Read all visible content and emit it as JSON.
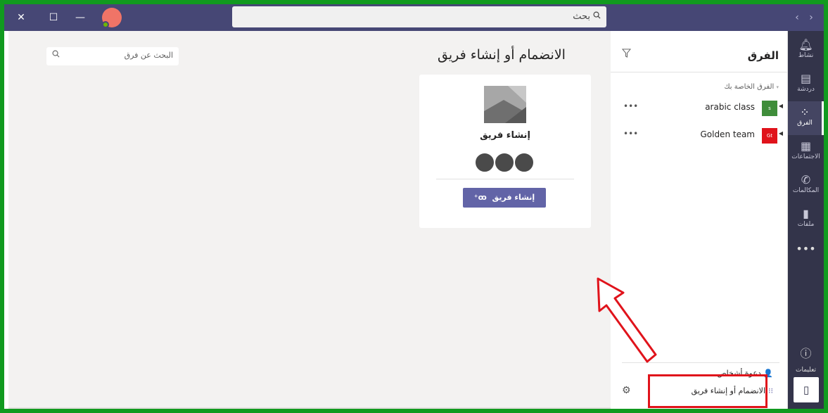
{
  "titlebar": {
    "close_icon": "✕",
    "maximize_icon": "☐",
    "minimize_icon": "—",
    "search_text": "بحث",
    "search_icon": "search-icon",
    "nav_back": "‹",
    "nav_forward": "›"
  },
  "rail": {
    "items": [
      {
        "label": "نشاط",
        "icon": "bell-icon"
      },
      {
        "label": "دردشة",
        "icon": "chat-icon"
      },
      {
        "label": "الفرق",
        "icon": "teams-icon"
      },
      {
        "label": "الاجتماعات",
        "icon": "calendar-icon"
      },
      {
        "label": "المكالمات",
        "icon": "phone-icon"
      },
      {
        "label": "ملفات",
        "icon": "file-icon"
      }
    ],
    "more": "•••",
    "help_label": "تعليمات"
  },
  "teams_pane": {
    "title": "الفرق",
    "section": "الفرق الخاصة بك",
    "teams": [
      {
        "name": "arabic class",
        "initials": "s",
        "color": "#3f8d3a",
        "more": "•••"
      },
      {
        "name": "Golden team",
        "initials": "Gt",
        "color": "#e0131b",
        "more": "•••"
      }
    ],
    "invite_label": "دعوة أشخاص",
    "join_label": "الانضمام أو إنشاء فريق"
  },
  "main": {
    "title": "الانضمام أو إنشاء فريق",
    "search_placeholder": "البحث عن فرق",
    "card": {
      "title": "إنشاء فريق",
      "button_label": "إنشاء فريق"
    }
  },
  "colors": {
    "frame": "#119a1f",
    "titlebar": "#464775",
    "rail": "#33344a",
    "accent": "#6264a7",
    "annotation": "#e0131b"
  }
}
